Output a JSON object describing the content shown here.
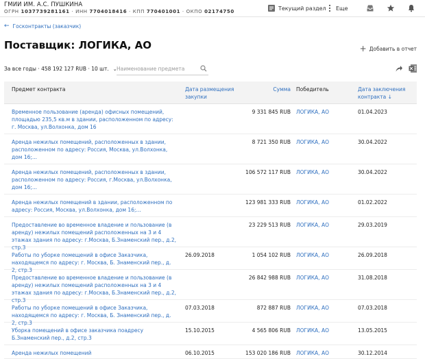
{
  "header": {
    "org_name": "ГМИИ ИМ. А.С. ПУШКИНА",
    "ogrn_label": "ОГРН",
    "ogrn": "1037739281161",
    "inn_label": "ИНН",
    "inn": "7704018416",
    "kpp_label": "КПП",
    "kpp": "770401001",
    "okpo_label": "ОКПО",
    "okpo": "02174750",
    "current_section": "Текущий раздел",
    "more": "Еще"
  },
  "nav": {
    "back_label": "Госконтракты (заказчик)"
  },
  "page": {
    "title": "Поставщик: ЛОГИКА, АО",
    "add_report": "Добавить в отчет",
    "summary": "За все годы · 458 192 127 RUB · 10 шт.",
    "search_placeholder": "Наименование предмета"
  },
  "table": {
    "columns": {
      "subject": "Предмет контракта",
      "date": "Дата размещения закупки",
      "sum": "Сумма",
      "winner": "Победитель",
      "contract_date": "Дата заключения контракта ↓"
    },
    "rows": [
      {
        "subject": "Временное пользование (аренда) офисных помещений, площадью 235,5 кв.м в здании, расположенном по адресу: г. Москва, ул.Волхонка, дом 16",
        "date": "",
        "sum": "9 331 845 RUB",
        "winner": "ЛОГИКА, АО",
        "contract_date": "01.04.2023"
      },
      {
        "subject": "Аренда нежилых помещений, расположенных в здании, расположенном по адресу: Россия, Москва, ул.Волхонка, дом 16;...",
        "date": "",
        "sum": "8 721 350 RUB",
        "winner": "ЛОГИКА, АО",
        "contract_date": "30.04.2022"
      },
      {
        "subject": "Аренда нежилых помещений, расположенных в здании, расположенном по адресу: Россия, г.Москва, ул.Волхонка, дом 16;...",
        "date": "",
        "sum": "106 572 117 RUB",
        "winner": "ЛОГИКА, АО",
        "contract_date": "30.04.2022"
      },
      {
        "subject": "Аренда нежилых помещений в здании, расположенном по адресу: Россия, Москва, ул.Волхонка, дом 16;...",
        "date": "",
        "sum": "123 981 333 RUB",
        "winner": "ЛОГИКА, АО",
        "contract_date": "01.02.2022"
      },
      {
        "subject": "Предоставление во временное владение и пользование (в аренду) нежилых помещений расположенных на 3 и 4 этажах здания по адресу: г.Москва, Б.Знаменский пер., д.2, стр.3",
        "date": "",
        "sum": "23 229 513 RUB",
        "winner": "ЛОГИКА, АО",
        "contract_date": "29.03.2019"
      },
      {
        "subject": "Работы по уборке помещений в офисе Заказчика, находящемся по адресу: г. Москва, Б. Знаменский пер., д. 2, стр.3",
        "date": "26.09.2018",
        "sum": "1 054 102 RUB",
        "winner": "ЛОГИКА, АО",
        "contract_date": "26.09.2018"
      },
      {
        "subject": "Предоставление во временное владение и пользование (в аренду) нежилых помещений расположенных на 3 и 4 этажах здания по адресу: г.Москва, Б.Знаменский пер., д.2, стр.3",
        "date": "",
        "sum": "26 842 988 RUB",
        "winner": "ЛОГИКА, АО",
        "contract_date": "31.08.2018"
      },
      {
        "subject": "Работы по уборке помещений в офисе Заказчика, находящемся по адресу: г. Москва, Б. Знаменский пер., д. 2, стр.3",
        "date": "07.03.2018",
        "sum": "872 887 RUB",
        "winner": "ЛОГИКА, АО",
        "contract_date": "07.03.2018"
      },
      {
        "subject": "Уборка помещений в офисе заказчика поадресу Б.Знаменский пер., д.2, стр.3",
        "date": "15.10.2015",
        "sum": "4 565 806 RUB",
        "winner": "ЛОГИКА, АО",
        "contract_date": "13.05.2015"
      },
      {
        "subject": "Аренда нежилых помещений",
        "date": "06.10.2015",
        "sum": "153 020 186 RUB",
        "winner": "ЛОГИКА, АО",
        "contract_date": "30.12.2014"
      }
    ]
  }
}
